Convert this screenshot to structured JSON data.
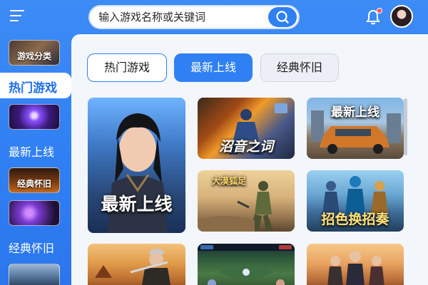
{
  "search": {
    "placeholder": "输入游戏名称或关键词"
  },
  "notifications": {
    "has_unread": true
  },
  "sidebar": {
    "items": [
      {
        "type": "thumb",
        "label": "游戏分类"
      },
      {
        "type": "active",
        "label": "热门游戏"
      },
      {
        "type": "thumb",
        "label": ""
      },
      {
        "type": "text",
        "label": "最新上线"
      },
      {
        "type": "thumb",
        "label": "经典怀旧"
      },
      {
        "type": "thumb",
        "label": ""
      },
      {
        "type": "text",
        "label": "经典怀旧"
      },
      {
        "type": "thumb",
        "label": ""
      }
    ]
  },
  "tabs": [
    {
      "label": "热门游戏",
      "state": "outline"
    },
    {
      "label": "最新上线",
      "state": "selected"
    },
    {
      "label": "经典怀旧",
      "state": "default"
    }
  ],
  "cards": [
    {
      "title": "最新上线",
      "theme": "hero"
    },
    {
      "title": "沼音之词",
      "theme": "blaze"
    },
    {
      "title": "最新上线",
      "theme": "car"
    },
    {
      "title": "大漠狐足",
      "theme": "desert"
    },
    {
      "title": "招色换招奏",
      "theme": "squad"
    },
    {
      "title": "",
      "theme": "warrior"
    },
    {
      "title": "",
      "theme": "moba"
    },
    {
      "title": "",
      "theme": "crew"
    }
  ],
  "colors": {
    "accent": "#2f80f3",
    "panel_bg": "#f3f6fb",
    "sidebar_bg": "#3d8bf5"
  }
}
